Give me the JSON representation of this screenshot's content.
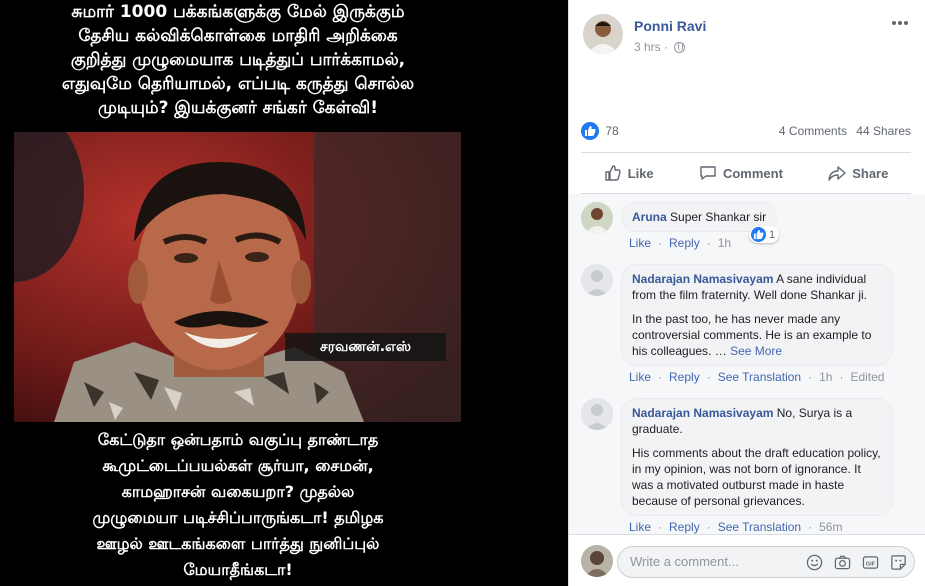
{
  "viewer": {
    "caption_top": "சுமார் 1000 பக்கங்களுக்கு மேல் இருக்கும்\nதேசிய கல்விக்கொள்கை மாதிரி அறிக்கை\nகுறித்து முழுமையாக படித்துப் பார்க்காமல்,\nஎதுவுமே தெரியாமல், எப்படி கருத்து சொல்ல\nமுடியும்? இயக்குனர் சங்கர் கேள்வி!",
    "watermark": "சரவணன்.எஸ்",
    "caption_bottom": "கேட்டுதா ஒன்பதாம் வகுப்பு தாண்டாத\nகூமுட்டைப்பயல்கள் சூர்யா, சைமன்,\nகாமஹாசன் வகையறா? முதல்ல\nமுழுமையா படிச்சிப்பாருங்கடா! தமிழக\nஊழல் ஊடகங்களை பார்த்து நுனிப்புல்\nமேயாதீங்கடா!"
  },
  "post": {
    "author": "Ponni Ravi",
    "time": "3 hrs",
    "more_icon": "ellipsis-icon",
    "reaction_count": "78",
    "comments_count": "4 Comments",
    "shares_count": "44 Shares",
    "actions": {
      "like": "Like",
      "comment": "Comment",
      "share": "Share"
    }
  },
  "comments": [
    {
      "author": "Aruna",
      "text": "Super Shankar sir",
      "paragraphs": [],
      "see_more": "",
      "like": "Like",
      "reply": "Reply",
      "translate": "",
      "time": "1h",
      "edited": "",
      "reactions": "1"
    },
    {
      "author": "Nadarajan Namasivayam",
      "text": "A sane individual from the film fraternity. Well done Shankar ji.",
      "paragraphs": [
        "In the past too, he has never made any controversial comments. He is an example to his colleagues. …"
      ],
      "see_more": "See More",
      "like": "Like",
      "reply": "Reply",
      "translate": "See Translation",
      "time": "1h",
      "edited": "Edited",
      "reactions": ""
    },
    {
      "author": "Nadarajan Namasivayam",
      "text": "No, Surya is a graduate.",
      "paragraphs": [
        "His comments about the draft education policy, in my opinion, was not born of ignorance. It was a motivated outburst made in haste because of personal grievances."
      ],
      "see_more": "",
      "like": "Like",
      "reply": "Reply",
      "translate": "See Translation",
      "time": "56m",
      "edited": "",
      "reactions": ""
    }
  ],
  "compose": {
    "placeholder": "Write a comment...",
    "icons": [
      "emoji-icon",
      "camera-icon",
      "gif-icon",
      "sticker-icon"
    ]
  },
  "colors": {
    "link_blue": "#385898",
    "like_blue": "#2078f4",
    "muted": "#90949c"
  }
}
